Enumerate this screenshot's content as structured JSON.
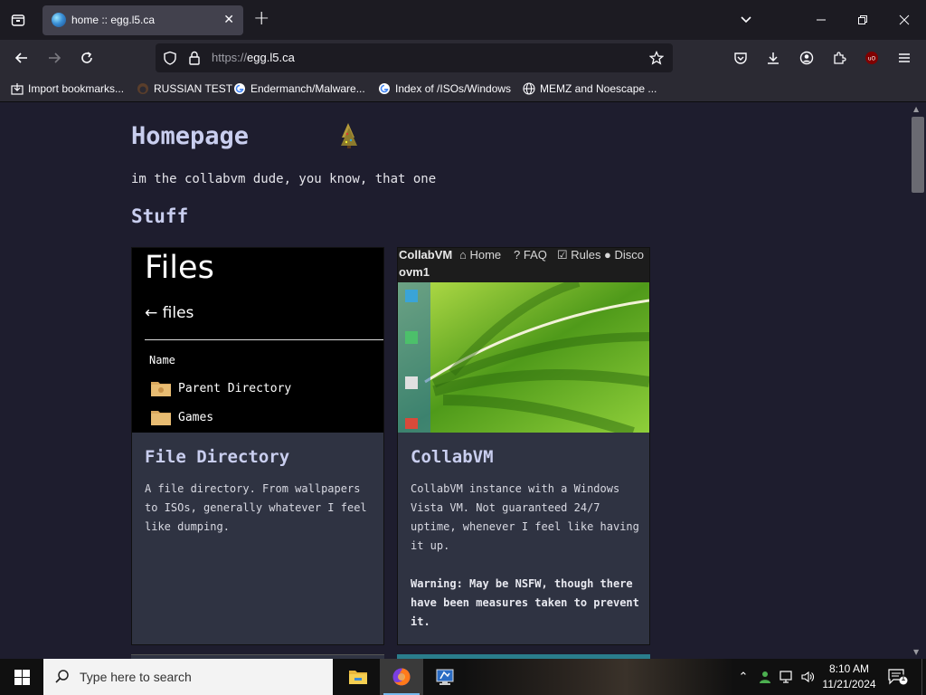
{
  "browser": {
    "tab": {
      "title": "home :: egg.l5.ca"
    },
    "url": {
      "scheme": "https://",
      "host": "egg.l5.ca"
    },
    "bookmarks": [
      {
        "label": "Import bookmarks...",
        "icon": "import-icon"
      },
      {
        "label": "RUSSIAN TEST",
        "icon": "hat-icon"
      },
      {
        "label": "Endermanch/Malware...",
        "icon": "google-icon"
      },
      {
        "label": "Index of /ISOs/Windows",
        "icon": "google-icon"
      },
      {
        "label": "MEMZ and Noescape ...",
        "icon": "globe-icon"
      }
    ]
  },
  "page": {
    "heading": "Homepage",
    "intro": "im the collabvm dude, you know, that one",
    "section": "Stuff",
    "cards": [
      {
        "title": "File Directory",
        "description": "A file directory. From wallpapers to ISOs, generally whatever I feel like dumping.",
        "preview": {
          "title": "Files",
          "back_link": "← files",
          "column": "Name",
          "rows": [
            "Parent Directory",
            "Games"
          ]
        }
      },
      {
        "title": "CollabVM",
        "description": "CollabVM instance with a Windows Vista VM. Not guaranteed 24/7 uptime, whenever I feel like having it up.",
        "warning": "Warning: May be NSFW, though there have been measures taken to prevent it.",
        "preview": {
          "brand": "CollabVM",
          "nav": [
            "Home",
            "FAQ",
            "Rules",
            "Disco"
          ],
          "vm": "ovm1"
        }
      }
    ]
  },
  "taskbar": {
    "search_placeholder": "Type here to search",
    "time": "8:10 AM",
    "date": "11/21/2024",
    "notifications": "1"
  },
  "colors": {
    "page_bg": "#1e1d2e",
    "card_bg": "#2f3342",
    "heading": "#c9ceef",
    "toolbar": "#2b2a33"
  }
}
